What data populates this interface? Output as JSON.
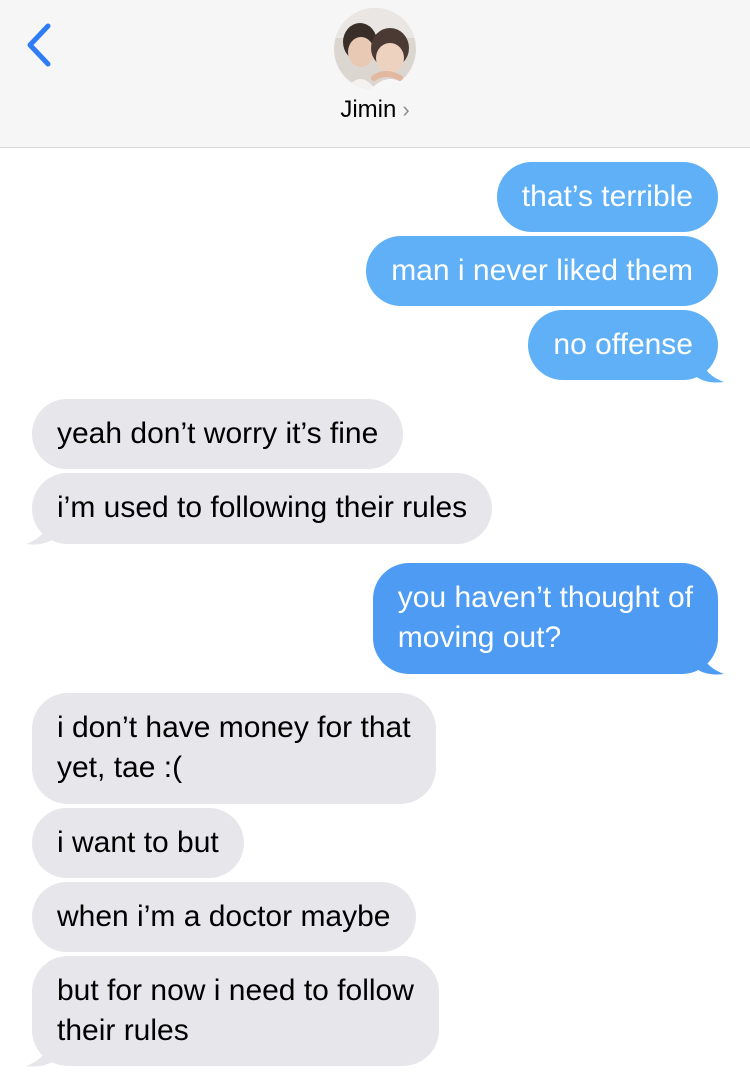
{
  "header": {
    "contact_name": "Jimin",
    "chevron": "›"
  },
  "colors": {
    "sent_bubble": "#5fb0f6",
    "sent_bubble_latest": "#4d9bf3",
    "received_bubble": "#e6e6eb",
    "back_accent": "#2f7df6"
  },
  "messages": [
    {
      "side": "sent",
      "text": "that’s terrible"
    },
    {
      "side": "sent",
      "text": "man i never liked them"
    },
    {
      "side": "sent",
      "text": "no offense"
    },
    {
      "side": "received",
      "text": "yeah don’t worry it’s fine"
    },
    {
      "side": "received",
      "text": "i’m used to following their rules"
    },
    {
      "side": "sent",
      "lines": [
        "you haven’t thought of",
        "moving out?"
      ]
    },
    {
      "side": "received",
      "lines": [
        "i don’t have money for that",
        "yet, tae :("
      ]
    },
    {
      "side": "received",
      "text": "i want to but"
    },
    {
      "side": "received",
      "text": "when i’m a doctor maybe"
    },
    {
      "side": "received",
      "lines": [
        "but for now i need to follow",
        "their rules"
      ]
    }
  ]
}
